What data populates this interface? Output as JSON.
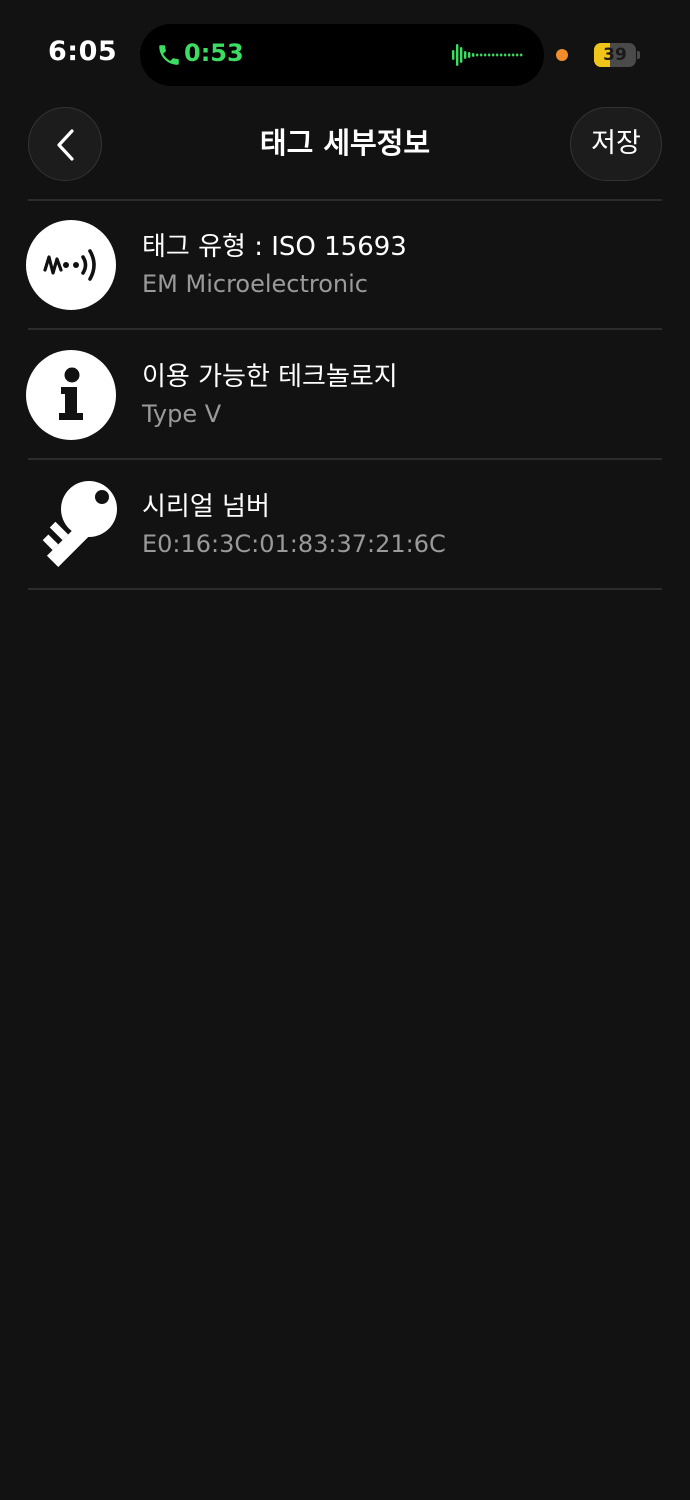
{
  "status_bar": {
    "time": "6:05",
    "call_timer": "0:53",
    "battery_level": "39",
    "battery_fraction": 0.39
  },
  "header": {
    "title": "태그 세부정보",
    "save_label": "저장"
  },
  "rows": [
    {
      "icon": "nfc-tag-icon",
      "title": "태그 유형 : ISO 15693",
      "subtitle": "EM Microelectronic"
    },
    {
      "icon": "info-icon",
      "title": "이용 가능한 테크놀로지",
      "subtitle": "Type V"
    },
    {
      "icon": "key-icon",
      "title": "시리얼 넘버",
      "subtitle": "E0:16:3C:01:83:37:21:6C"
    }
  ],
  "colors": {
    "background": "#121212",
    "call_green": "#3ddc62",
    "battery_yellow": "#f0c419",
    "mic_indicator": "#f28b2a",
    "subtitle_gray": "#9a9a9a"
  }
}
